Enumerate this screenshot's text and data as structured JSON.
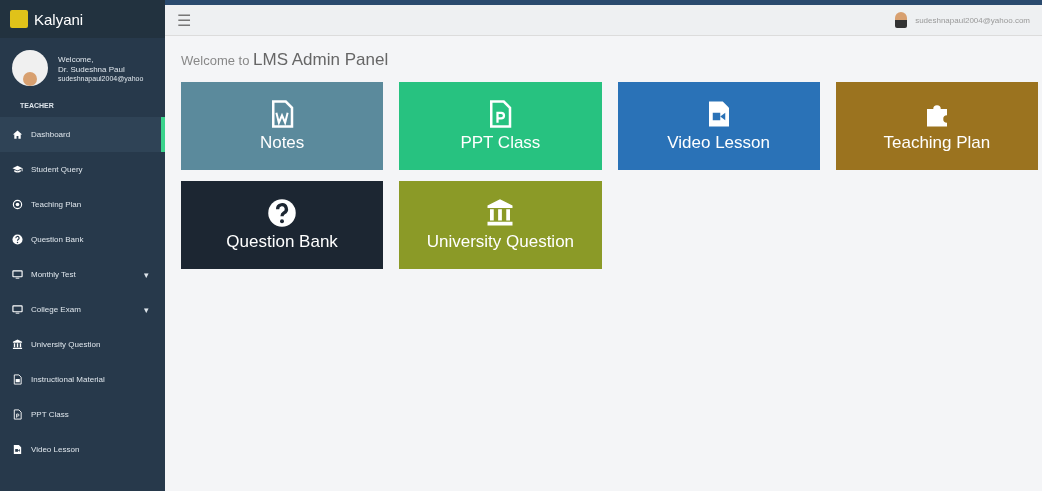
{
  "sidebar": {
    "brand": "Kalyani",
    "user": {
      "greeting": "Welcome,",
      "name": "Dr. Sudeshna Paul",
      "email": "sudeshnapaul2004@yahoo"
    },
    "role": "TEACHER",
    "items": [
      {
        "label": "Dashboard",
        "selected": true
      },
      {
        "label": "Student Query",
        "selected": false
      },
      {
        "label": "Teaching Plan",
        "selected": false
      },
      {
        "label": "Question Bank",
        "selected": false
      },
      {
        "label": "Monthly Test",
        "selected": false,
        "caret": "▾"
      },
      {
        "label": "College Exam",
        "selected": false,
        "caret": "▾"
      },
      {
        "label": "University Question",
        "selected": false
      },
      {
        "label": "Instructional Material",
        "selected": false
      },
      {
        "label": "PPT Class",
        "selected": false
      },
      {
        "label": "Video Lesson",
        "selected": false
      }
    ]
  },
  "topbar": {
    "menu_icon": "☰",
    "user_email": "sudeshnapaul2004@yahoo.com"
  },
  "heading": {
    "prefix": "Welcome to",
    "title": "LMS Admin Panel"
  },
  "tiles": [
    {
      "label": "Notes",
      "color": "#5b8a9c"
    },
    {
      "label": "PPT Class",
      "color": "#27c280"
    },
    {
      "label": "Video Lesson",
      "color": "#2a72b7"
    },
    {
      "label": "Teaching Plan",
      "color": "#9b731f"
    },
    {
      "label": "Question Bank",
      "color": "#1c2632"
    },
    {
      "label": "University Question",
      "color": "#8b9a27"
    }
  ]
}
